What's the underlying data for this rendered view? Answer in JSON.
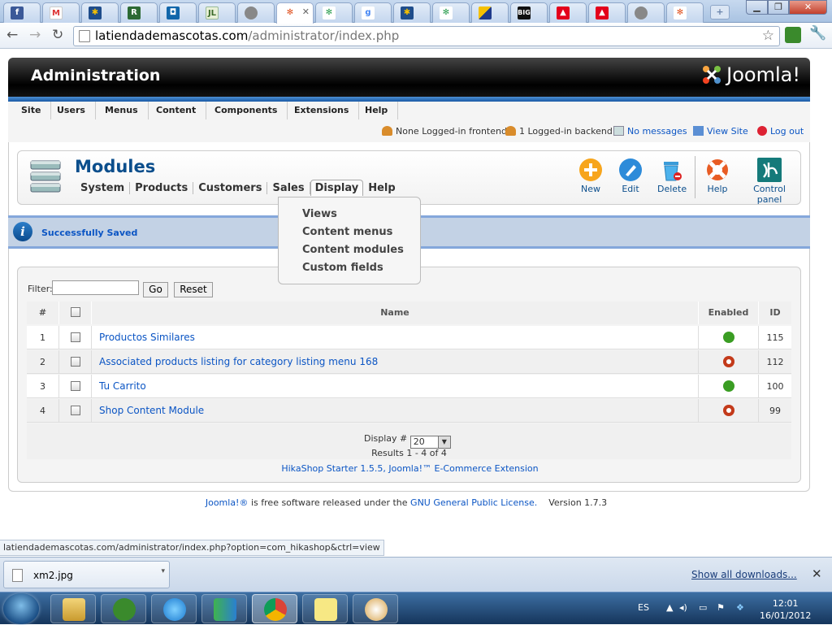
{
  "browser": {
    "url_host": "latiendademascotas.com",
    "url_path": "/administrator/index.php",
    "status_url": "latiendademascotas.com/administrator/index.php?option=com_hikashop&ctrl=view"
  },
  "header": {
    "title": "Administration",
    "logo_text": "Joomla!"
  },
  "menu": [
    "Site",
    "Users",
    "Menus",
    "Content",
    "Components",
    "Extensions",
    "Help"
  ],
  "status": {
    "frontend": "None Logged-in frontend",
    "backend": "1 Logged-in backend",
    "messages": "No messages",
    "view_site": "View Site",
    "logout": "Log out"
  },
  "toolbar": {
    "page_title": "Modules",
    "subnav": [
      "System",
      "Products",
      "Customers",
      "Sales",
      "Display",
      "Help"
    ],
    "buttons": [
      "New",
      "Edit",
      "Delete",
      "Help",
      "Control panel"
    ]
  },
  "dropdown": [
    "Views",
    "Content menus",
    "Content modules",
    "Custom fields"
  ],
  "message": "Successfully Saved",
  "filter": {
    "label": "Filter:",
    "value": "",
    "go": "Go",
    "reset": "Reset"
  },
  "table": {
    "headers": [
      "#",
      "Name",
      "Enabled",
      "ID"
    ],
    "rows": [
      {
        "num": "1",
        "name": "Productos Similares",
        "enabled": true,
        "id": "115"
      },
      {
        "num": "2",
        "name": "Associated products listing for category listing menu 168",
        "enabled": false,
        "id": "112"
      },
      {
        "num": "3",
        "name": "Tu Carrito",
        "enabled": true,
        "id": "100"
      },
      {
        "num": "4",
        "name": "Shop Content Module",
        "enabled": false,
        "id": "99"
      }
    ],
    "display_label": "Display #",
    "display_value": "20",
    "results": "Results 1 - 4 of 4"
  },
  "powered": "HikaShop Starter 1.5.5, Joomla!™ E-Commerce Extension",
  "license": {
    "joomla": "Joomla!®",
    "middle": "is free software released under the",
    "gpl": "GNU General Public License.",
    "version": "Version 1.7.3"
  },
  "downloads": {
    "file": "xm2.jpg",
    "show_all": "Show all downloads..."
  },
  "tray": {
    "lang": "ES",
    "time": "12:01",
    "date": "16/01/2012"
  },
  "colors": {
    "link": "#0b55c4",
    "enabled": "#3a9d23",
    "disabled": "#c33a1a",
    "accent": "#1a5aa5"
  }
}
